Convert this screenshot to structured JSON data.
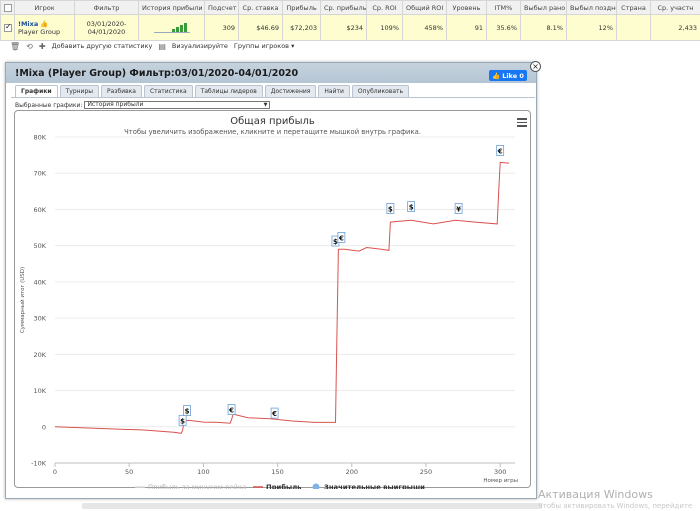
{
  "stats": {
    "headers": [
      "",
      "Игрок",
      "Фильтр",
      "История прибыли",
      "Подсчет",
      "Ср. ставка",
      "Прибыль",
      "Ср. прибыль",
      "Ср. ROI",
      "Общий ROI",
      "Уровень",
      "ITM%",
      "Выбыл рано",
      "Выбыл поздно",
      "Страна",
      "Ср. участн"
    ],
    "row": {
      "player_name": "!Mixa",
      "player_group": "Player Group",
      "filter_line1": "03/01/2020-",
      "filter_line2": "04/01/2020",
      "count": "309",
      "avg_stake": "$46.69",
      "profit": "$72,203",
      "avg_profit": "$234",
      "avg_roi": "109%",
      "total_roi": "458%",
      "level": "91",
      "itm": "35.6%",
      "early": "8.1%",
      "late": "12%",
      "country": "",
      "avg_entrants": "2,433"
    }
  },
  "toolbar": {
    "add_stats": "Добавить другую статистику",
    "visualize": "Визуализируйте",
    "player_groups": "Группы игроков ▾"
  },
  "popup": {
    "title": "!Mixa (Player Group) Фильтр:03/01/2020-04/01/2020",
    "like_label": "Like 0",
    "close_label": "×",
    "tabs": [
      "Графики",
      "Турниры",
      "Разбивка",
      "Статистика",
      "Таблицы лидеров",
      "Достижения",
      "Найти",
      "Опубликовать"
    ],
    "graph_select_label": "Выбранные графики:",
    "graph_select_value": "История прибыли"
  },
  "chart_data": {
    "type": "line",
    "title": "Общая прибыль",
    "subtitle": "Чтобы увеличить изображение, кликните и перетащите мышкой внутрь графика.",
    "xlabel": "Номер игры",
    "ylabel": "Суммарный итог (USD)",
    "xlim": [
      0,
      310
    ],
    "ylim": [
      -10000,
      80000
    ],
    "x_ticks": [
      "0",
      "50",
      "100",
      "150",
      "200",
      "250",
      "300"
    ],
    "x_tick_values": [
      0,
      50,
      100,
      150,
      200,
      250,
      300
    ],
    "y_ticks": [
      "-10K",
      "0",
      "10K",
      "20K",
      "30K",
      "40K",
      "50K",
      "60K",
      "70K",
      "80K"
    ],
    "y_tick_values": [
      -10000,
      0,
      10000,
      20000,
      30000,
      40000,
      50000,
      60000,
      70000,
      80000
    ],
    "legend": [
      "Прибыль за минусом рейка",
      "Прибыль",
      "Значительные выигрыши"
    ],
    "legend_position": "bottom",
    "series": [
      {
        "name": "Прибыль",
        "color": "#d9534f",
        "points": [
          [
            0,
            0
          ],
          [
            20,
            -300
          ],
          [
            40,
            -600
          ],
          [
            60,
            -900
          ],
          [
            80,
            -1500
          ],
          [
            85,
            -1800
          ],
          [
            86,
            -1000
          ],
          [
            87,
            1500
          ],
          [
            90,
            1800
          ],
          [
            100,
            1300
          ],
          [
            110,
            1200
          ],
          [
            118,
            1000
          ],
          [
            119,
            2000
          ],
          [
            120,
            3500
          ],
          [
            130,
            2500
          ],
          [
            145,
            2200
          ],
          [
            160,
            1600
          ],
          [
            175,
            1200
          ],
          [
            189,
            1200
          ],
          [
            190,
            25000
          ],
          [
            191,
            49000
          ],
          [
            195,
            49000
          ],
          [
            205,
            48500
          ],
          [
            210,
            49500
          ],
          [
            220,
            49000
          ],
          [
            225,
            48700
          ],
          [
            226,
            56500
          ],
          [
            240,
            57000
          ],
          [
            255,
            56000
          ],
          [
            270,
            57000
          ],
          [
            283,
            56500
          ],
          [
            298,
            56000
          ],
          [
            299,
            65000
          ],
          [
            300,
            73000
          ],
          [
            306,
            72800
          ]
        ]
      }
    ],
    "markers": [
      {
        "x": 86,
        "y": 1500,
        "symbol": "$"
      },
      {
        "x": 89,
        "y": 4200,
        "symbol": "$"
      },
      {
        "x": 119,
        "y": 4500,
        "symbol": "€"
      },
      {
        "x": 148,
        "y": 3500,
        "symbol": "€"
      },
      {
        "x": 189,
        "y": 51000,
        "symbol": "$"
      },
      {
        "x": 193,
        "y": 52000,
        "symbol": "€"
      },
      {
        "x": 226,
        "y": 60000,
        "symbol": "$"
      },
      {
        "x": 240,
        "y": 60500,
        "symbol": "$"
      },
      {
        "x": 272,
        "y": 60000,
        "symbol": "¥"
      },
      {
        "x": 300,
        "y": 76000,
        "symbol": "€"
      }
    ]
  },
  "watermark": {
    "title": "Активация Windows",
    "subtitle": "Чтобы активировать Windows, перейдите"
  }
}
